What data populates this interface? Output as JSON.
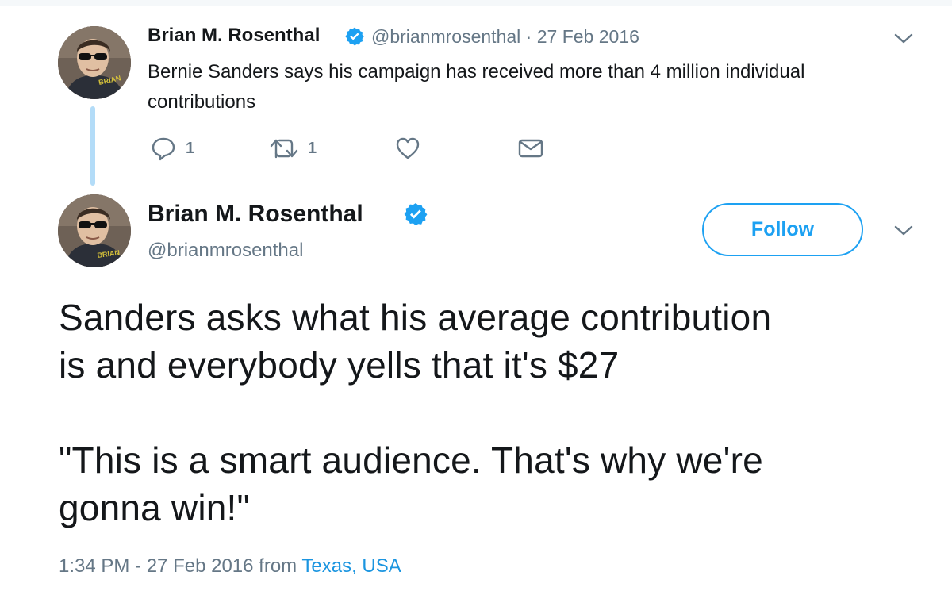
{
  "parent_tweet": {
    "author_name": "Brian M. Rosenthal",
    "author_handle": "@brianmrosenthal",
    "separator": "·",
    "date": "27 Feb 2016",
    "text": "Bernie Sanders says his campaign has received more than 4 million individual contributions",
    "avatar_caption": "BRIAN",
    "actions": {
      "reply_icon": "reply-icon",
      "reply_count": "1",
      "retweet_icon": "retweet-icon",
      "retweet_count": "1",
      "like_icon": "heart-icon",
      "dm_icon": "envelope-icon"
    }
  },
  "main_tweet": {
    "author_name": "Brian M. Rosenthal",
    "author_handle": "@brianmrosenthal",
    "avatar_caption": "BRIAN",
    "follow_label": "Follow",
    "text_lines": [
      "Sanders asks what his average contribution",
      "is and everybody yells that it's $27",
      "\"This is a smart audience. That's why we're",
      "gonna win!\""
    ],
    "timestamp": "1:34 PM - 27 Feb 2016",
    "from_label": "from",
    "location": "Texas, USA"
  },
  "colors": {
    "brand_blue": "#1da1f2",
    "link_blue": "#1b95e0",
    "muted_gray": "#657786",
    "thread_line": "#b3dcf8"
  }
}
